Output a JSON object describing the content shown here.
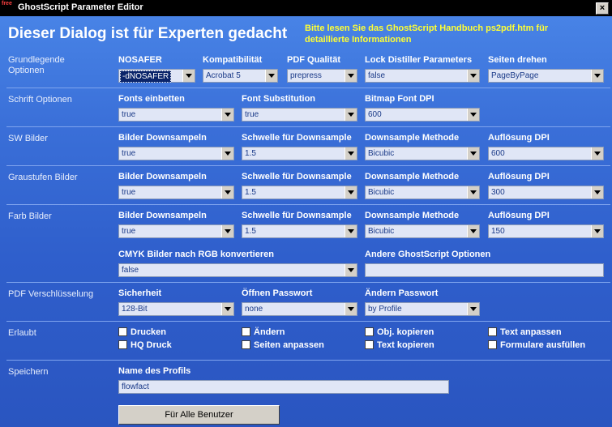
{
  "window": {
    "title": "GhostScript Parameter Editor",
    "icon_text": "free",
    "close_glyph": "×"
  },
  "header": {
    "headline": "Dieser Dialog ist für Experten gedacht",
    "hint_line1": "Bitte lesen Sie das GhostScript Handbuch ps2pdf.htm für",
    "hint_line2": "detaillierte Informationen"
  },
  "sections": {
    "basic": {
      "line1": "Grundlegende",
      "line2": "Optionen"
    },
    "fonts": "Schrift Optionen",
    "bw": "SW Bilder",
    "gray": "Graustufen Bilder",
    "color": "Farb Bilder",
    "encryption": "PDF Verschlüsselung",
    "permissions": "Erlaubt",
    "save": "Speichern"
  },
  "basic": {
    "nosafer": {
      "label": "NOSAFER",
      "value": "-dNOSAFER"
    },
    "compat": {
      "label": "Kompatibilität",
      "value": "Acrobat 5"
    },
    "quality": {
      "label": "PDF Qualität",
      "value": "prepress"
    },
    "lock": {
      "label": "Lock Distiller Parameters",
      "value": "false"
    },
    "rotate": {
      "label": "Seiten drehen",
      "value": "PageByPage"
    }
  },
  "fonts": {
    "embed": {
      "label": "Fonts einbetten",
      "value": "true"
    },
    "subst": {
      "label": "Font Substitution",
      "value": "true"
    },
    "dpi": {
      "label": "Bitmap Font DPI",
      "value": "600"
    }
  },
  "bw": {
    "downsample": {
      "label": "Bilder Downsampeln",
      "value": "true"
    },
    "threshold": {
      "label": "Schwelle für Downsample",
      "value": "1.5"
    },
    "method": {
      "label": "Downsample Methode",
      "value": "Bicubic"
    },
    "resolution": {
      "label": "Auflösung DPI",
      "value": "600"
    }
  },
  "gray": {
    "downsample": {
      "label": "Bilder Downsampeln",
      "value": "true"
    },
    "threshold": {
      "label": "Schwelle für Downsample",
      "value": "1.5"
    },
    "method": {
      "label": "Downsample Methode",
      "value": "Bicubic"
    },
    "resolution": {
      "label": "Auflösung DPI",
      "value": "300"
    }
  },
  "color": {
    "downsample": {
      "label": "Bilder Downsampeln",
      "value": "true"
    },
    "threshold": {
      "label": "Schwelle für Downsample",
      "value": "1.5"
    },
    "method": {
      "label": "Downsample Methode",
      "value": "Bicubic"
    },
    "resolution": {
      "label": "Auflösung DPI",
      "value": "150"
    },
    "cmyk": {
      "label": "CMYK Bilder nach RGB konvertieren",
      "value": "false"
    },
    "other": {
      "label": "Andere GhostScript Optionen",
      "value": ""
    }
  },
  "encryption": {
    "security": {
      "label": "Sicherheit",
      "value": "128-Bit"
    },
    "open_pw": {
      "label": "Öffnen Passwort",
      "value": "none"
    },
    "change_pw": {
      "label": "Ändern Passwort",
      "value": "by Profile"
    }
  },
  "permissions": {
    "print": "Drucken",
    "change": "Ändern",
    "copy_obj": "Obj. kopieren",
    "annotate": "Text anpassen",
    "hq_print": "HQ Druck",
    "assemble": "Seiten anpassen",
    "copy_text": "Text kopieren",
    "forms": "Formulare ausfüllen"
  },
  "save": {
    "profile_label": "Name des Profils",
    "profile_value": "flowfact",
    "button_label": "Für Alle Benutzer"
  }
}
